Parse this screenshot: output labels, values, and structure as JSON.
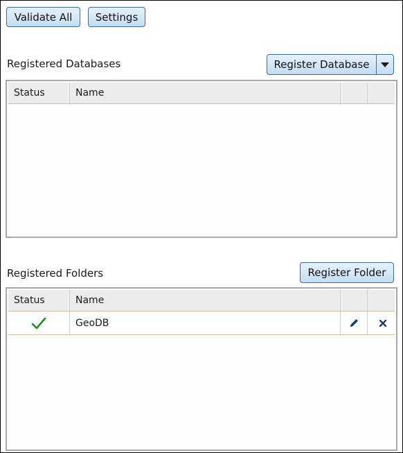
{
  "toolbar": {
    "validate_all_label": "Validate All",
    "settings_label": "Settings"
  },
  "databases": {
    "title": "Registered Databases",
    "register_label": "Register Database",
    "columns": [
      "Status",
      "Name",
      "",
      ""
    ],
    "rows": []
  },
  "folders": {
    "title": "Registered Folders",
    "register_label": "Register Folder",
    "columns": [
      "Status",
      "Name",
      "",
      ""
    ],
    "rows": [
      {
        "status": "check-icon",
        "name": "GeoDB",
        "edit": "pencil-icon",
        "remove": "close-icon"
      }
    ]
  },
  "colors": {
    "button_border": "#3f6b97",
    "button_fill": "#c5ddf2",
    "check_green": "#1f8a1f",
    "icon_blue": "#1c3d6b",
    "row_separator": "#d9b9a4"
  }
}
